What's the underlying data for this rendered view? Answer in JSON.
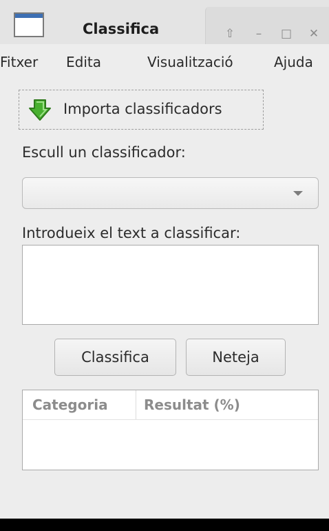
{
  "window": {
    "title": "Classifica",
    "controls": {
      "restore_glyph": "⇧",
      "minimize_glyph": "–",
      "maximize_glyph": "□",
      "close_glyph": "✕"
    }
  },
  "menubar": {
    "items": [
      {
        "label": "Fitxer"
      },
      {
        "label": "Edita"
      },
      {
        "label": "Visualització"
      },
      {
        "label": "Ajuda"
      }
    ]
  },
  "import": {
    "label": "Importa classificadors",
    "icon": "green-down-arrow-icon"
  },
  "classifier": {
    "label": "Escull un classificador:",
    "selected": ""
  },
  "text_input": {
    "label": "Introdueix el text a classificar:",
    "value": ""
  },
  "actions": {
    "classify_label": "Classifica",
    "clear_label": "Neteja"
  },
  "results": {
    "columns": [
      "Categoria",
      "Resultat (%)"
    ],
    "rows": []
  },
  "colors": {
    "accent_arrow": "#3c9a2a",
    "title_icon_bar": "#3d6fb3"
  }
}
